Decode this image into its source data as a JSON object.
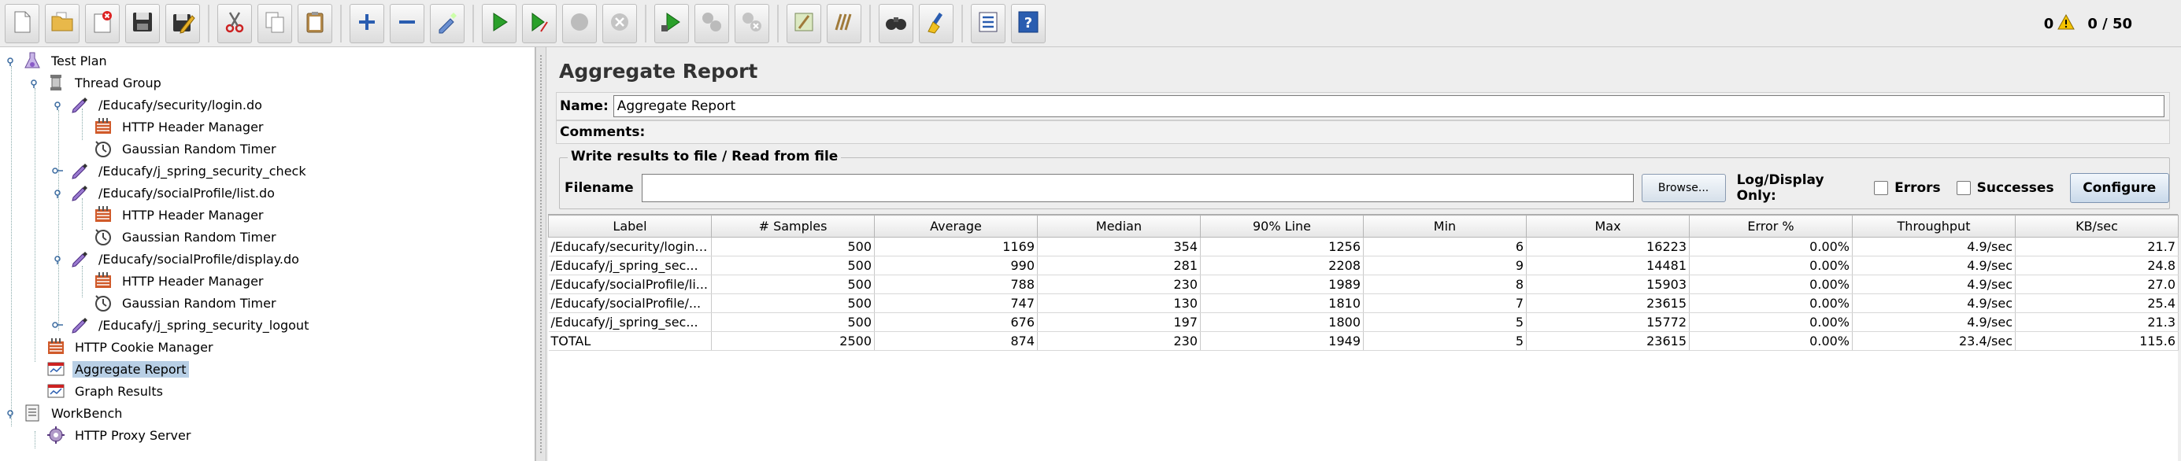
{
  "toolbar": {
    "buttons": [
      {
        "name": "new-icon"
      },
      {
        "name": "open-icon"
      },
      {
        "name": "close-icon"
      },
      {
        "name": "save-icon"
      },
      {
        "name": "save-as-icon"
      },
      {
        "name": "cut-icon"
      },
      {
        "name": "copy-icon"
      },
      {
        "name": "paste-icon"
      },
      {
        "name": "expand-icon"
      },
      {
        "name": "collapse-icon"
      },
      {
        "name": "toggle-icon"
      },
      {
        "name": "start-icon"
      },
      {
        "name": "start-no-pause-icon"
      },
      {
        "name": "stop-icon"
      },
      {
        "name": "shutdown-icon"
      },
      {
        "name": "remote-start-icon"
      },
      {
        "name": "remote-stop-icon"
      },
      {
        "name": "remote-shutdown-icon"
      },
      {
        "name": "clear-icon"
      },
      {
        "name": "clear-all-icon"
      },
      {
        "name": "search-icon"
      },
      {
        "name": "reset-search-icon"
      },
      {
        "name": "function-helper-icon"
      },
      {
        "name": "help-icon"
      }
    ],
    "warnings_count": "0",
    "threads_status": "0 / 50"
  },
  "tree": {
    "nodes": [
      {
        "label": "Test Plan",
        "icon": "flask-icon"
      },
      {
        "label": "Thread Group",
        "icon": "spool-icon"
      },
      {
        "label": "/Educafy/security/login.do",
        "icon": "pipette-icon"
      },
      {
        "label": "HTTP Header Manager",
        "icon": "header-manager-icon"
      },
      {
        "label": "Gaussian Random Timer",
        "icon": "timer-icon"
      },
      {
        "label": "/Educafy/j_spring_security_check",
        "icon": "pipette-icon"
      },
      {
        "label": "/Educafy/socialProfile/list.do",
        "icon": "pipette-icon"
      },
      {
        "label": "HTTP Header Manager",
        "icon": "header-manager-icon"
      },
      {
        "label": "Gaussian Random Timer",
        "icon": "timer-icon"
      },
      {
        "label": "/Educafy/socialProfile/display.do",
        "icon": "pipette-icon"
      },
      {
        "label": "HTTP Header Manager",
        "icon": "header-manager-icon"
      },
      {
        "label": "Gaussian Random Timer",
        "icon": "timer-icon"
      },
      {
        "label": "/Educafy/j_spring_security_logout",
        "icon": "pipette-icon"
      },
      {
        "label": "HTTP Cookie Manager",
        "icon": "cookie-manager-icon"
      },
      {
        "label": "Aggregate Report",
        "icon": "report-icon"
      },
      {
        "label": "Graph Results",
        "icon": "graph-icon"
      },
      {
        "label": "WorkBench",
        "icon": "workbench-icon"
      },
      {
        "label": "HTTP Proxy Server",
        "icon": "proxy-icon"
      }
    ]
  },
  "main": {
    "title": "Aggregate Report",
    "name_label": "Name:",
    "name_value": "Aggregate Report",
    "comments_label": "Comments:",
    "file_legend": "Write results to file / Read from file",
    "filename_label": "Filename",
    "browse_label": "Browse...",
    "log_only_label": "Log/Display Only:",
    "errors_label": "Errors",
    "successes_label": "Successes",
    "configure_label": "Configure"
  },
  "table": {
    "headers": [
      "Label",
      "# Samples",
      "Average",
      "Median",
      "90% Line",
      "Min",
      "Max",
      "Error %",
      "Throughput",
      "KB/sec"
    ],
    "rows": [
      [
        "/Educafy/security/login....",
        "500",
        "1169",
        "354",
        "1256",
        "6",
        "16223",
        "0.00%",
        "4.9/sec",
        "21.7"
      ],
      [
        "/Educafy/j_spring_sec...",
        "500",
        "990",
        "281",
        "2208",
        "9",
        "14481",
        "0.00%",
        "4.9/sec",
        "24.8"
      ],
      [
        "/Educafy/socialProfile/li...",
        "500",
        "788",
        "230",
        "1989",
        "8",
        "15903",
        "0.00%",
        "4.9/sec",
        "27.0"
      ],
      [
        "/Educafy/socialProfile/...",
        "500",
        "747",
        "130",
        "1810",
        "7",
        "23615",
        "0.00%",
        "4.9/sec",
        "25.4"
      ],
      [
        "/Educafy/j_spring_sec...",
        "500",
        "676",
        "197",
        "1800",
        "5",
        "15772",
        "0.00%",
        "4.9/sec",
        "21.3"
      ],
      [
        "TOTAL",
        "2500",
        "874",
        "230",
        "1949",
        "5",
        "23615",
        "0.00%",
        "23.4/sec",
        "115.6"
      ]
    ]
  }
}
